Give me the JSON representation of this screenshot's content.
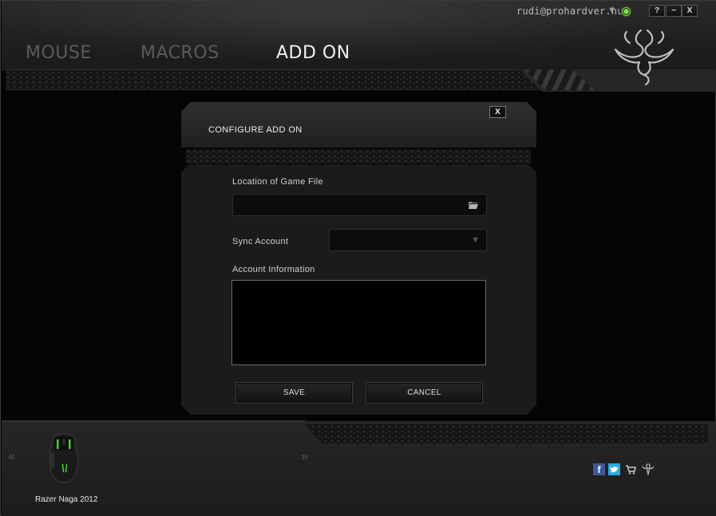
{
  "header": {
    "tabs": [
      {
        "label": "MOUSE",
        "active": false
      },
      {
        "label": "MACROS",
        "active": false
      },
      {
        "label": "ADD ON",
        "active": true
      }
    ],
    "user": "rudi@prohardver.hu",
    "window_buttons": {
      "help": "?",
      "minimize": "−",
      "close": "X"
    }
  },
  "dialog": {
    "title": "CONFIGURE ADD ON",
    "close_label": "X",
    "location_label": "Location of Game File",
    "location_value": "",
    "sync_label": "Sync Account",
    "sync_value": "",
    "account_info_label": "Account Information",
    "account_info_value": "",
    "save_label": "SAVE",
    "cancel_label": "CANCEL"
  },
  "footer": {
    "device_name": "Razer Naga 2012",
    "prev_arrow": "«",
    "next_arrow": "»",
    "social": [
      "facebook-icon",
      "twitter-icon",
      "cart-icon",
      "razer-icon"
    ]
  },
  "colors": {
    "accent_green": "#44d62c",
    "background": "#050505",
    "facebook": "#3b5998",
    "twitter": "#2aa9e0"
  }
}
